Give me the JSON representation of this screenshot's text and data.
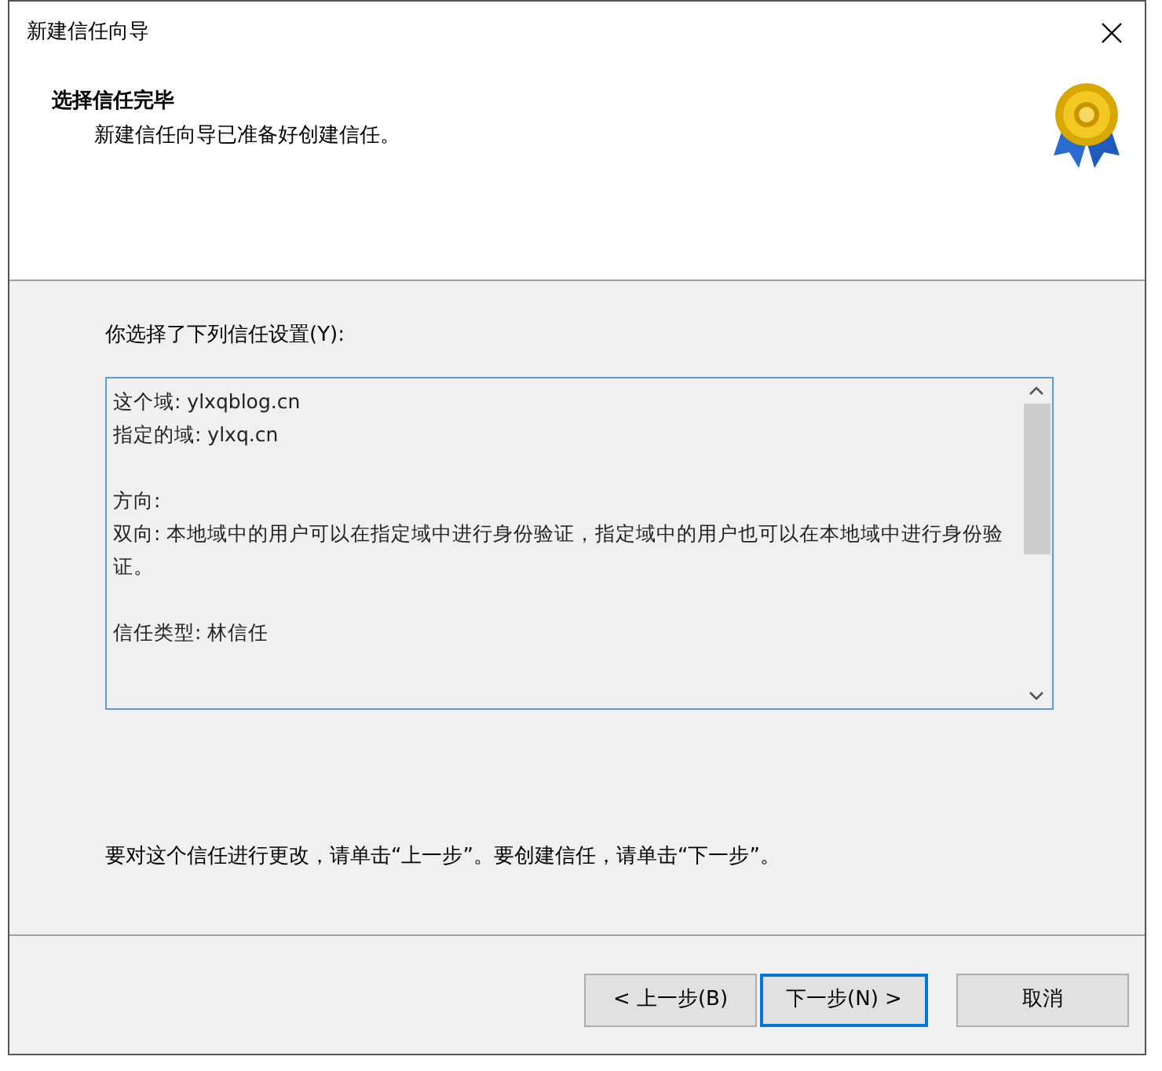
{
  "window": {
    "title": "新建信任向导"
  },
  "header": {
    "title": "选择信任完毕",
    "subtitle": "新建信任向导已准备好创建信任。"
  },
  "summary_label": "你选择了下列信任设置(Y):",
  "summary_groups": [
    [
      "这个域: ylxqblog.cn",
      "指定的域: ylxq.cn"
    ],
    [
      "方向:",
      "双向: 本地域中的用户可以在指定域中进行身份验证，指定域中的用户也可以在本地域中进行身份验证。"
    ],
    [
      "信任类型: 林信任"
    ]
  ],
  "hint": "要对这个信任进行更改，请单击“上一步”。要创建信任，请单击“下一步”。",
  "buttons": [
    {
      "label": "< 上一步(B)",
      "selected": false
    },
    {
      "label": "下一步(N) >",
      "selected": true
    },
    {
      "label": "取消",
      "selected": false
    }
  ]
}
